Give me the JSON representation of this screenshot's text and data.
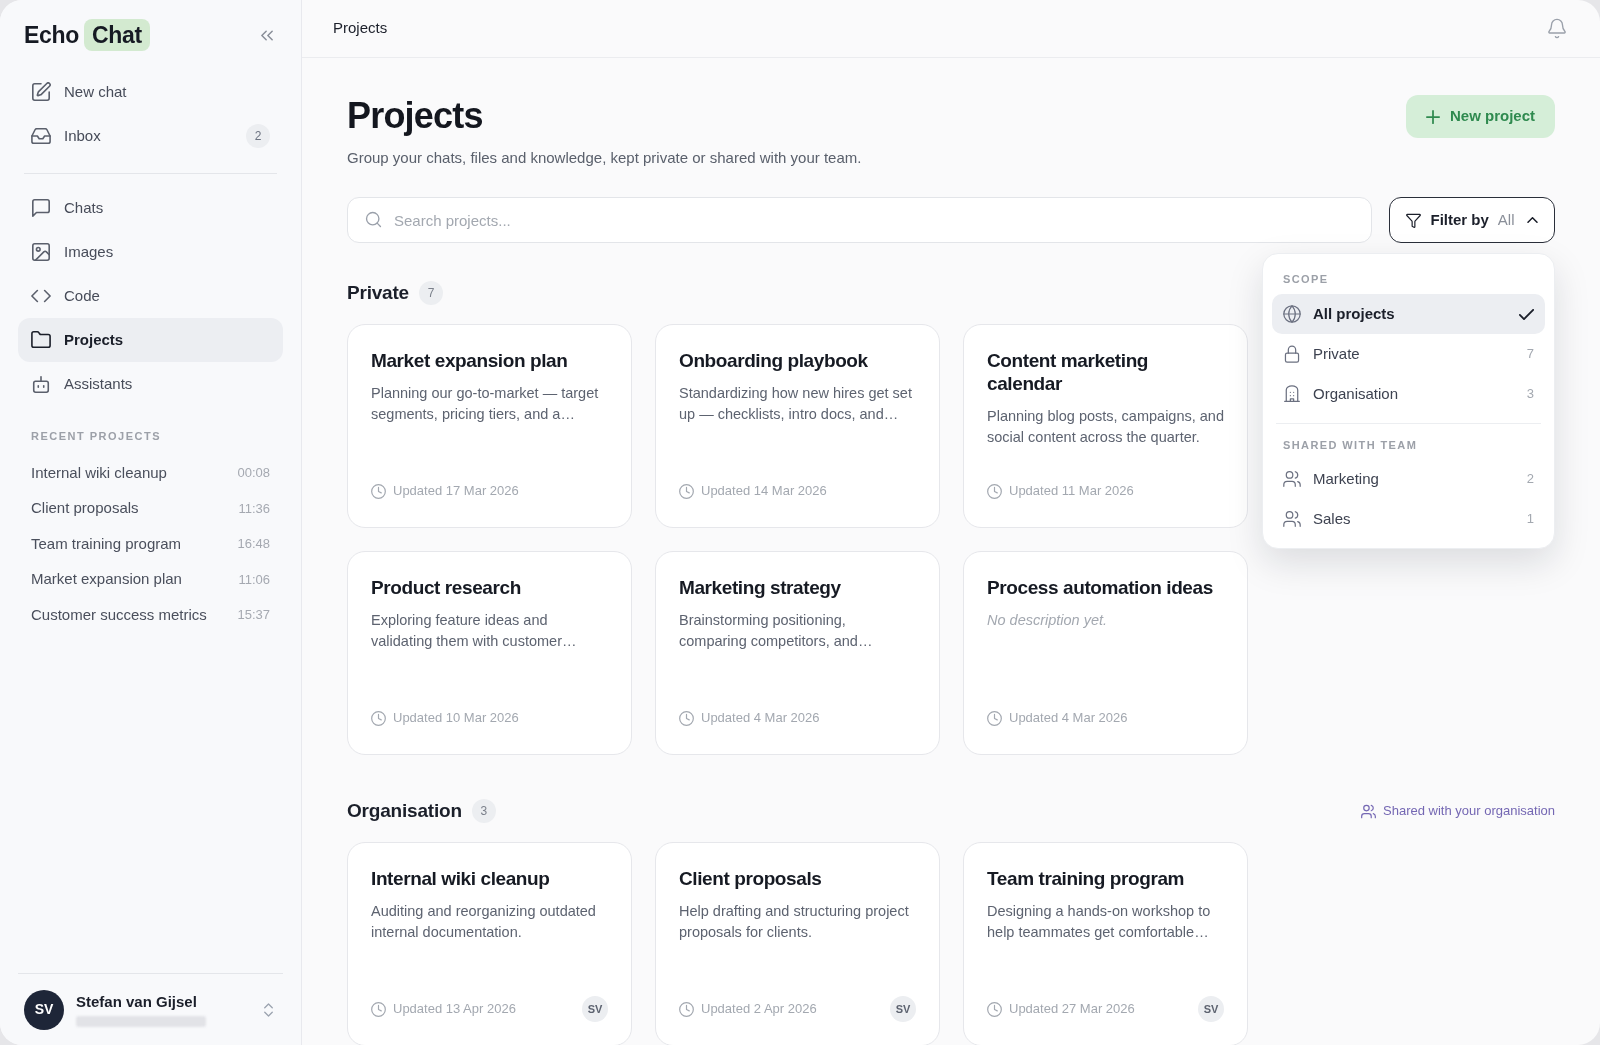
{
  "sidebar": {
    "logo": {
      "wordmark": "Echo",
      "highlight": "Chat"
    },
    "nav_groups": [
      {
        "items": [
          {
            "label": "New chat",
            "selected": false
          },
          {
            "label": "Inbox",
            "badge": "2",
            "selected": false
          }
        ]
      },
      {
        "items": [
          {
            "label": "Chats",
            "selected": false
          },
          {
            "label": "Images",
            "selected": false
          },
          {
            "label": "Code",
            "selected": false
          },
          {
            "label": "Projects",
            "selected": true
          },
          {
            "label": "Assistants",
            "selected": false
          }
        ]
      }
    ],
    "recent_projects": {
      "heading": "RECENT PROJECTS",
      "items": [
        {
          "title": "Internal wiki cleanup",
          "time": "00:08"
        },
        {
          "title": "Client proposals",
          "time": "11:36"
        },
        {
          "title": "Team training program",
          "time": "16:48"
        },
        {
          "title": "Market expansion plan",
          "time": "11:06"
        },
        {
          "title": "Customer success metrics",
          "time": "15:37"
        }
      ]
    },
    "user": {
      "initials": "SV",
      "name": "Stefan van Gijsel"
    }
  },
  "top_bar": {
    "title": "Projects"
  },
  "page": {
    "title": "Projects",
    "subtitle": "Group your chats, files and knowledge, kept private or shared with your team.",
    "new_project_button": "New project"
  },
  "search": {
    "placeholder": "Search projects..."
  },
  "filter": {
    "label": "Filter by",
    "value": "All",
    "expanded": true,
    "menu": [
      {
        "heading": "SCOPE",
        "items": [
          {
            "label": "All projects",
            "selected": true
          },
          {
            "label": "Private",
            "count": "7",
            "selected": false
          },
          {
            "label": "Organisation",
            "count": "3",
            "selected": false
          }
        ]
      },
      {
        "heading": "SHARED WITH TEAM",
        "items": [
          {
            "label": "Marketing",
            "count": "2",
            "selected": false
          },
          {
            "label": "Sales",
            "count": "1",
            "selected": false
          }
        ]
      }
    ]
  },
  "sections": [
    {
      "title": "Private",
      "count": "7",
      "projects": [
        {
          "title": "Market expansion plan",
          "description": "Planning our go-to-market — target segments, pricing tiers, and a…",
          "updated": "Updated 17 Mar 2026"
        },
        {
          "title": "Onboarding playbook",
          "description": "Standardizing how new hires get set up — checklists, intro docs, and…",
          "updated": "Updated 14 Mar 2026"
        },
        {
          "title": "Content marketing calendar",
          "description": "Planning blog posts, campaigns, and social content across the quarter.",
          "updated": "Updated 11 Mar 2026"
        },
        {
          "title": "Product research",
          "description": "Exploring feature ideas and validating them with customer…",
          "updated": "Updated 10 Mar 2026"
        },
        {
          "title": "Marketing strategy",
          "description": "Brainstorming positioning, comparing competitors, and…",
          "updated": "Updated 4 Mar 2026"
        },
        {
          "title": "Process automation ideas",
          "description_placeholder": "No description yet.",
          "updated": "Updated 4 Mar 2026"
        }
      ]
    },
    {
      "title": "Organisation",
      "count": "3",
      "note": "Shared with your organisation",
      "projects": [
        {
          "title": "Internal wiki cleanup",
          "description": "Auditing and reorganizing outdated internal documentation.",
          "updated": "Updated 13 Apr 2026",
          "owner_initials": "SV"
        },
        {
          "title": "Client proposals",
          "description": "Help drafting and structuring project proposals for clients.",
          "updated": "Updated 2 Apr 2026",
          "owner_initials": "SV"
        },
        {
          "title": "Team training program",
          "description": "Designing a hands-on workshop to help teammates get comfortable…",
          "updated": "Updated 27 Mar 2026",
          "owner_initials": "SV"
        }
      ]
    }
  ]
}
